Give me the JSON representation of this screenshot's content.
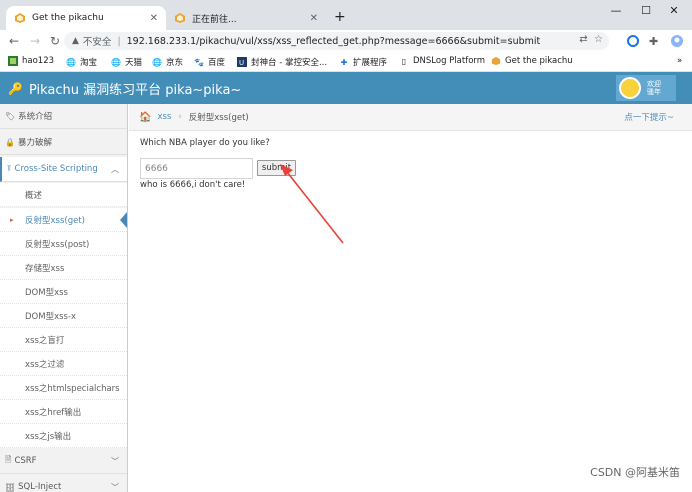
{
  "browser": {
    "tabs": [
      {
        "title": "Get the pikachu",
        "active": true
      },
      {
        "title": "正在前往...",
        "active": false
      }
    ],
    "window_controls": {
      "minimize": "—",
      "maximize": "☐",
      "close": "✕"
    },
    "address": {
      "security_label": "不安全",
      "url": "192.168.233.1/pikachu/vul/xss/xss_reflected_get.php?message=6666&submit=submit"
    },
    "bookmarks": [
      {
        "label": "hao123",
        "icon": "hao123-icon"
      },
      {
        "label": "淘宝",
        "icon": "globe-icon"
      },
      {
        "label": "天猫",
        "icon": "globe-icon"
      },
      {
        "label": "京东",
        "icon": "globe-icon"
      },
      {
        "label": "百度",
        "icon": "baidu-icon"
      },
      {
        "label": "封神台 - 掌控安全...",
        "icon": "site-icon"
      },
      {
        "label": "扩展程序",
        "icon": "puzzle-icon"
      },
      {
        "label": "DNSLog Platform",
        "icon": "document-icon"
      },
      {
        "label": "Get the pikachu",
        "icon": "pikachu-icon"
      }
    ],
    "more_bookmarks": "»"
  },
  "header": {
    "brand": "Pikachu 漏洞练习平台 pika~pika~",
    "welcome": "欢迎\n骚年"
  },
  "sidebar": {
    "items": [
      {
        "label": "系统介绍"
      },
      {
        "label": "暴力破解"
      },
      {
        "label": "Cross-Site Scripting"
      }
    ],
    "sub_items": [
      {
        "label": "概述"
      },
      {
        "label": "反射型xss(get)"
      },
      {
        "label": "反射型xss(post)"
      },
      {
        "label": "存储型xss"
      },
      {
        "label": "DOM型xss"
      },
      {
        "label": "DOM型xss-x"
      },
      {
        "label": "xss之盲打"
      },
      {
        "label": "xss之过滤"
      },
      {
        "label": "xss之htmlspecialchars"
      },
      {
        "label": "xss之href输出"
      },
      {
        "label": "xss之js输出"
      }
    ],
    "bottom_items": [
      {
        "label": "CSRF"
      },
      {
        "label": "SQL-Inject"
      }
    ]
  },
  "breadcrumb": {
    "section": "xss",
    "current": "反射型xss(get)",
    "hint": "点一下提示~"
  },
  "form": {
    "question": "Which NBA player do you like?",
    "input_value": "6666",
    "submit_label": "submit",
    "result": "who is 6666,i don't care!"
  },
  "watermark": "CSDN @阿基米笛",
  "colors": {
    "header_bg": "#438eb9",
    "accent": "#4b88b7",
    "arrow": "#e8413a"
  }
}
